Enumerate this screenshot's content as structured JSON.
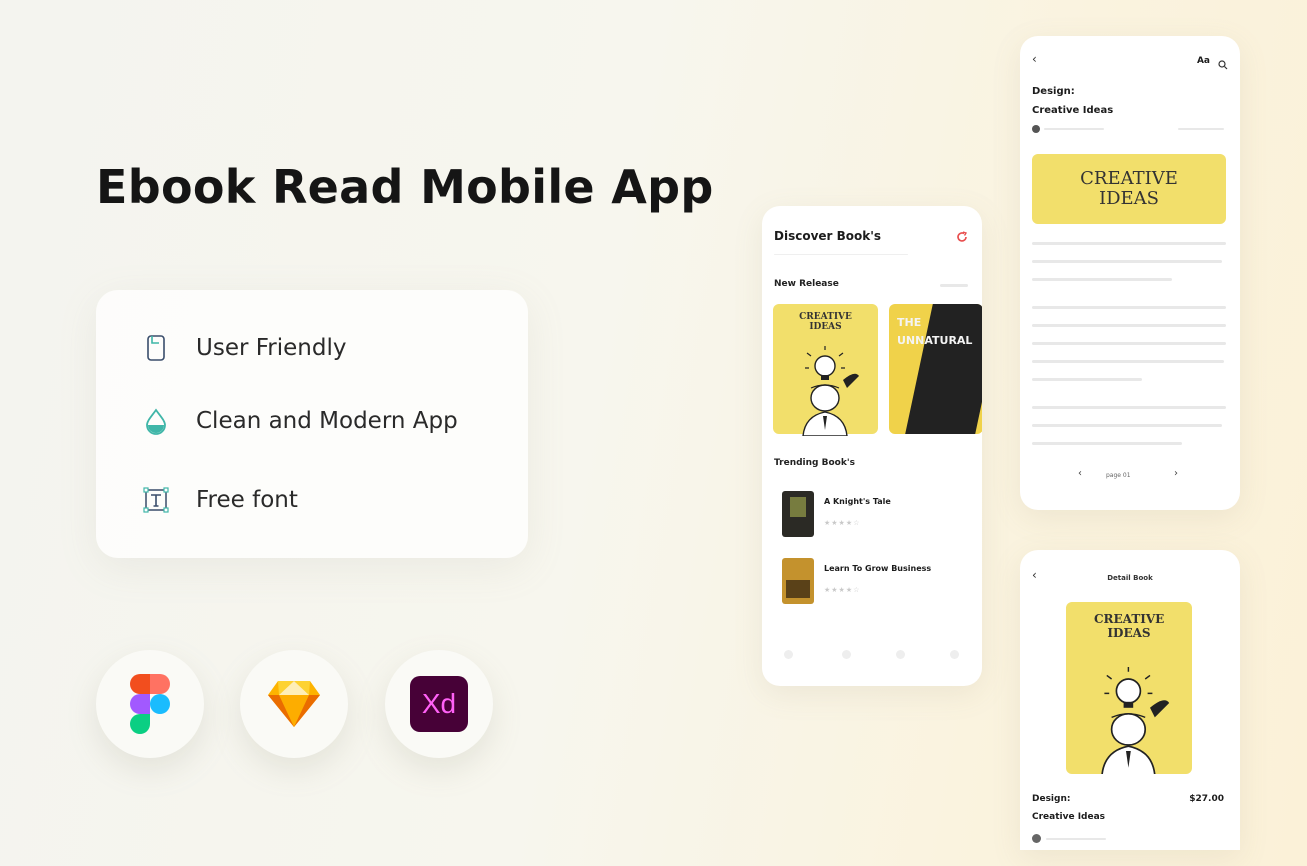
{
  "headline": "Ebook Read Mobile App",
  "features": [
    {
      "label": "User Friendly",
      "icon": "phone-icon"
    },
    {
      "label": "Clean and Modern App",
      "icon": "drop-icon"
    },
    {
      "label": "Free font",
      "icon": "text-tool-icon"
    }
  ],
  "tools": [
    {
      "name": "figma-logo"
    },
    {
      "name": "sketch-logo"
    },
    {
      "name": "xd-logo",
      "text": "Xd"
    }
  ],
  "colors": {
    "accent_teal": "#3fb6a8",
    "yellow": "#f2df6b",
    "xd_purple": "#470137",
    "xd_pink": "#ff61f6"
  },
  "discover": {
    "title": "Discover Book's",
    "new_release": "New Release",
    "trending": "Trending Book's",
    "cover1": "CREATIVE IDEAS",
    "cover2": "THE UNNATURAL",
    "trending_items": [
      {
        "title": "A Knight's Tale"
      },
      {
        "title": "Learn To Grow Business"
      }
    ]
  },
  "reader": {
    "font_btn": "Aa",
    "category": "Design:",
    "book_title": "Creative Ideas",
    "banner": "CREATIVE IDEAS",
    "page_label": "page 01"
  },
  "detail": {
    "title": "Detail Book",
    "cover": "CREATIVE IDEAS",
    "category": "Design:",
    "price": "$27.00",
    "book_title": "Creative Ideas"
  }
}
